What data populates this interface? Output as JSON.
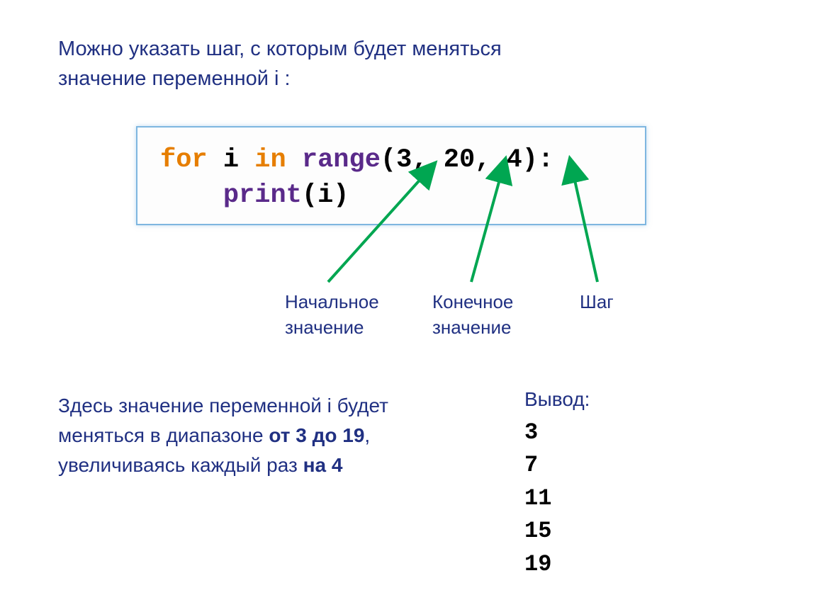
{
  "intro": "Можно указать шаг, с которым будет меняться значение переменной i :",
  "code": {
    "for": "for",
    "i": " i ",
    "in": "in",
    "sp1": " ",
    "range": "range",
    "args": "(3, 20, 4):",
    "indent": "    ",
    "print": "print",
    "parg": "(i)"
  },
  "labels": {
    "start": "Начальное значение",
    "end": "Конечное значение",
    "step": "Шаг"
  },
  "desc": {
    "part1": "Здесь значение переменной i будет меняться в диапазоне ",
    "bold1": "от 3 до 19",
    "part2": ", увеличиваясь каждый раз ",
    "bold2": "на 4"
  },
  "output": {
    "title": "Вывод:",
    "values": [
      "3",
      "7",
      "11",
      "15",
      "19"
    ]
  }
}
